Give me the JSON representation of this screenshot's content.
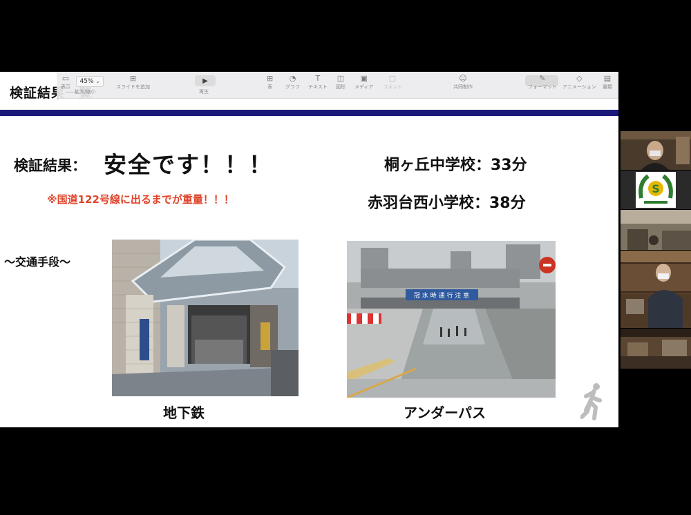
{
  "toolbar": {
    "zoom_value": "45%",
    "items": [
      {
        "icon": "sidebar-icon",
        "label": "表示"
      },
      {
        "icon": "zoom-icon",
        "label": "拡大/縮小"
      },
      {
        "icon": "add-slide-icon",
        "label": "スライドを追加"
      },
      {
        "icon": "play-icon",
        "label": "再生"
      },
      {
        "icon": "table-icon",
        "label": "表"
      },
      {
        "icon": "chart-icon",
        "label": "グラフ"
      },
      {
        "icon": "text-icon",
        "label": "テキスト"
      },
      {
        "icon": "shape-icon",
        "label": "図形"
      },
      {
        "icon": "media-icon",
        "label": "メディア"
      },
      {
        "icon": "comment-icon",
        "label": "コメント"
      },
      {
        "icon": "collaborate-icon",
        "label": "共同制作"
      },
      {
        "icon": "format-icon",
        "label": "フォーマット"
      },
      {
        "icon": "animate-icon",
        "label": "アニメーション"
      },
      {
        "icon": "document-icon",
        "label": "書類"
      }
    ]
  },
  "slide": {
    "title": "検証結果一覧",
    "result_label": "検証結果：",
    "result_value": "安全です！！！",
    "note": "※国道122号線に出るまでが重量！！！",
    "schools": [
      {
        "text": "桐ヶ丘中学校：33分"
      },
      {
        "text": "赤羽台西小学校：38分"
      }
    ],
    "transport_heading": "〜交通手段〜",
    "photos": [
      {
        "caption": "地下鉄"
      },
      {
        "caption": "アンダーパス"
      }
    ],
    "underpass_sign": "冠 水 時 通 行 注 意"
  },
  "colors": {
    "divider": "#1a1a7a",
    "note": "#e0442a",
    "background": "#000000"
  },
  "participants": [
    {
      "name": "participant-1"
    },
    {
      "name": "participant-2-logo"
    },
    {
      "name": "participant-3"
    },
    {
      "name": "participant-4"
    },
    {
      "name": "participant-5"
    }
  ]
}
